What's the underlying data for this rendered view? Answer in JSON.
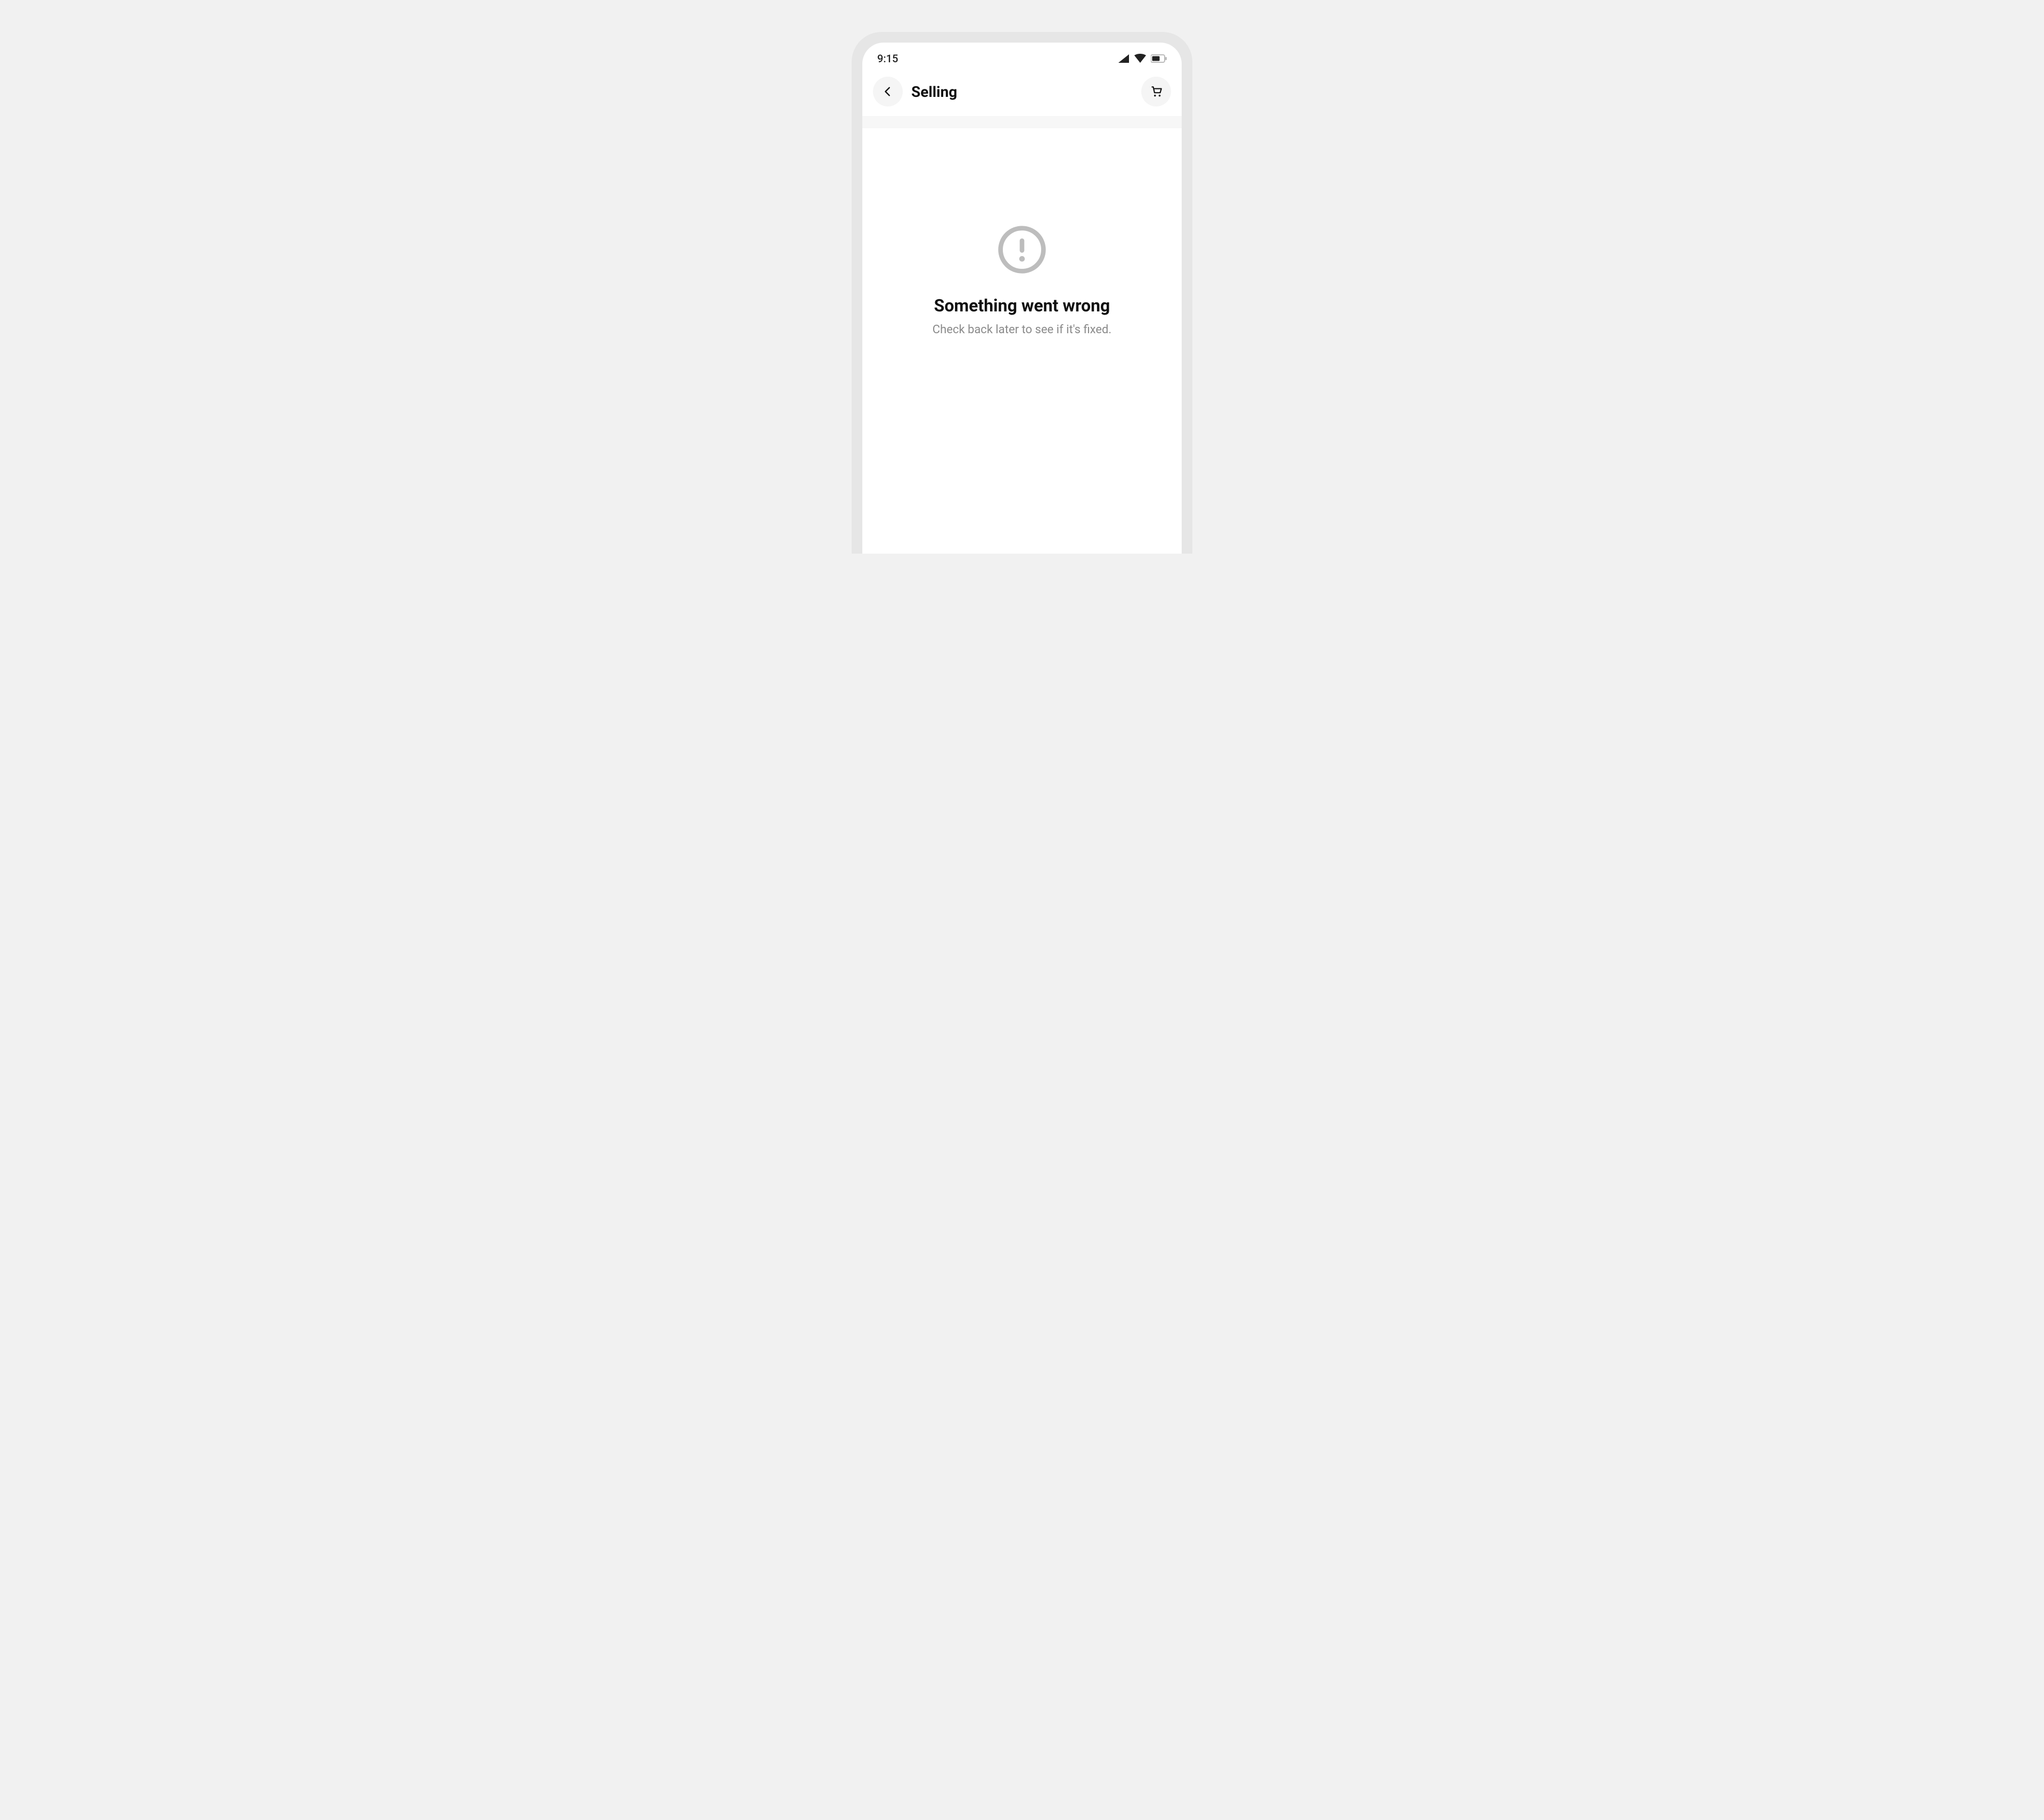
{
  "status_bar": {
    "time": "9:15"
  },
  "app_bar": {
    "title": "Selling"
  },
  "error": {
    "heading": "Something went wrong",
    "subtext": "Check back later to see if it's fixed."
  }
}
